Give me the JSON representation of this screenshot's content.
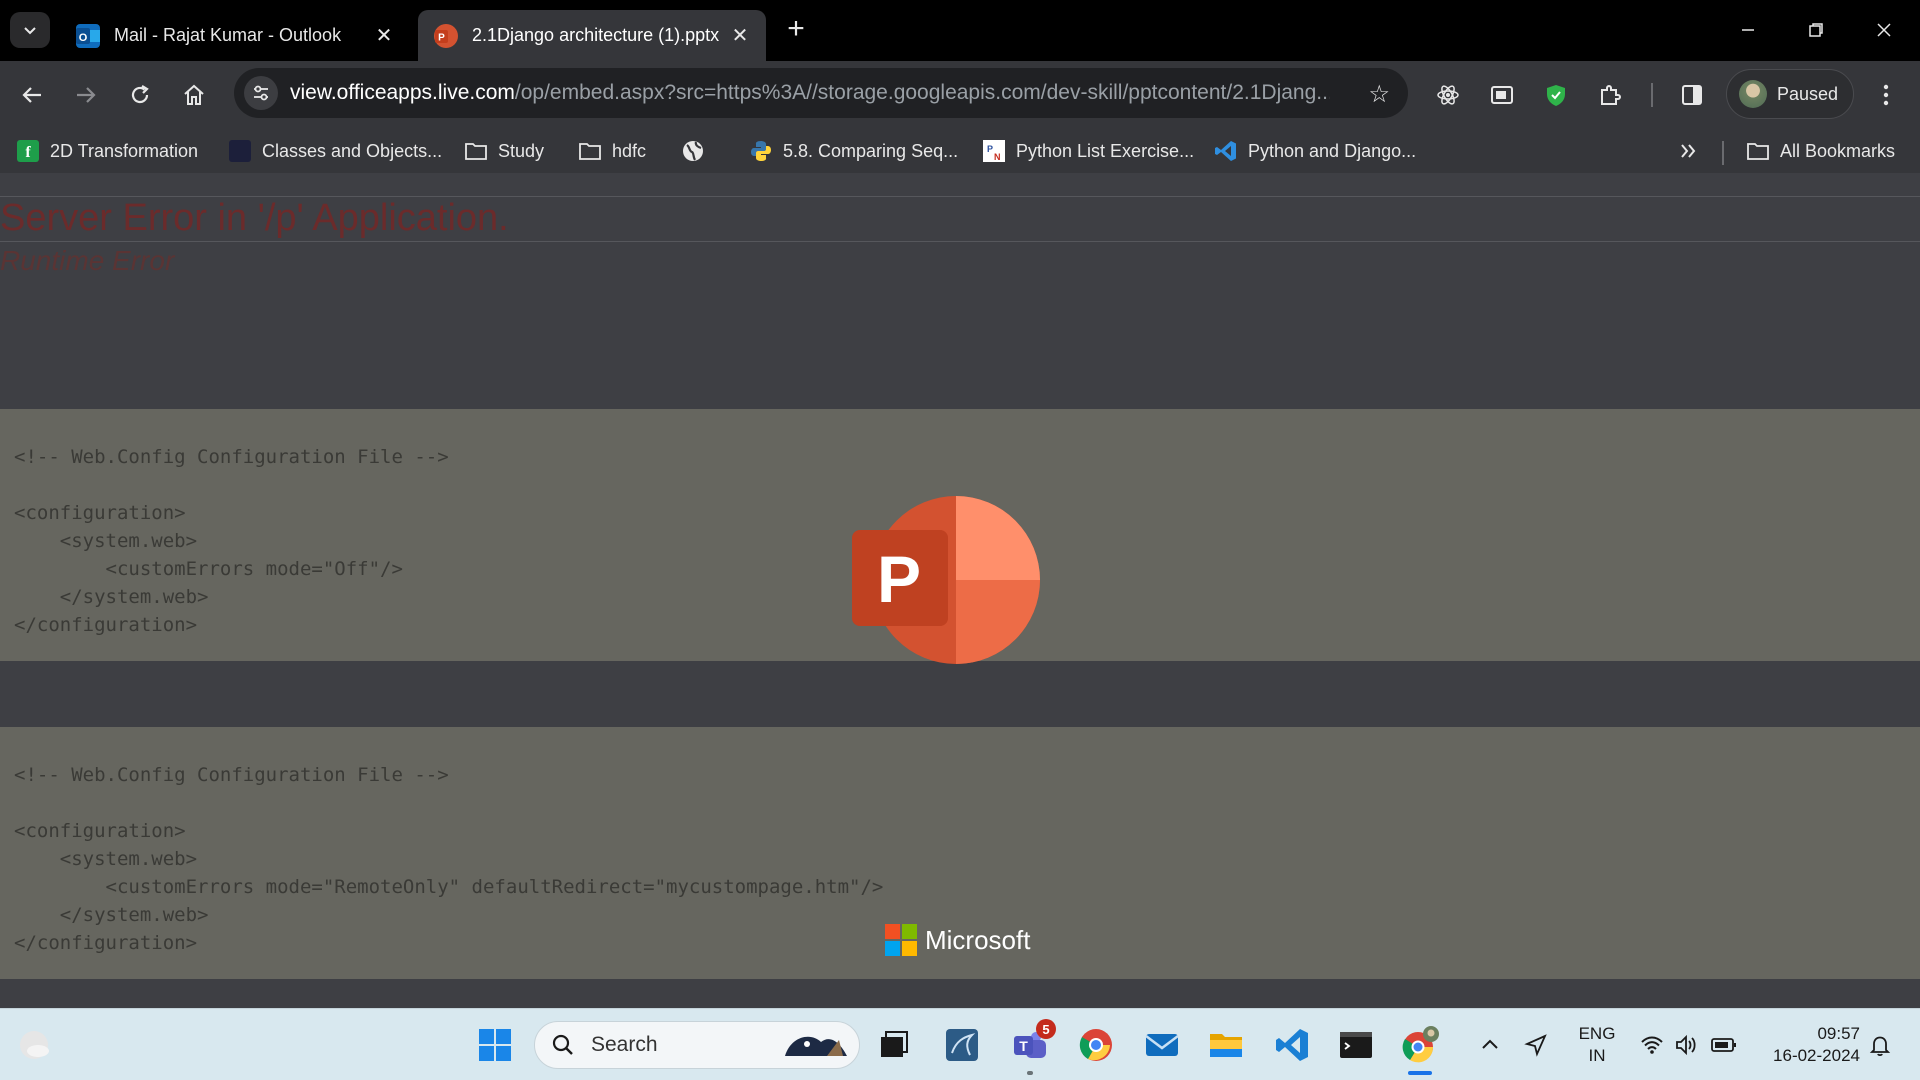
{
  "browser": {
    "tabs": [
      {
        "title": "Mail - Rajat Kumar - Outlook",
        "icon": "outlook-icon",
        "active": false
      },
      {
        "title": "2.1Django architecture (1).pptx",
        "icon": "powerpoint-icon",
        "active": true
      }
    ],
    "url_host": "view.officeapps.live.com",
    "url_path": "/op/embed.aspx?src=https%3A//storage.googleapis.com/dev-skill/pptcontent/2.1Djang...",
    "profile_status": "Paused"
  },
  "bookmarks": [
    {
      "label": "2D Transformation",
      "icon": "green-app-icon"
    },
    {
      "label": "Classes and Objects...",
      "icon": "dark-site-icon"
    },
    {
      "label": "Study",
      "icon": "folder-icon"
    },
    {
      "label": "hdfc",
      "icon": "folder-icon"
    },
    {
      "label": "",
      "icon": "globe-icon"
    },
    {
      "label": "5.8. Comparing Seq...",
      "icon": "python-icon"
    },
    {
      "label": "Python List Exercise...",
      "icon": "pynative-icon"
    },
    {
      "label": "Python and Django...",
      "icon": "vscode-icon"
    },
    {
      "label": "All Bookmarks",
      "icon": "folder-icon"
    }
  ],
  "page": {
    "error_title": "Server Error in '/p' Application.",
    "error_subtitle": "Runtime Error",
    "code_block_1": "<!-- Web.Config Configuration File -->\n\n<configuration>\n    <system.web>\n        <customErrors mode=\"Off\"/>\n    </system.web>\n</configuration>",
    "code_block_2": "<!-- Web.Config Configuration File -->\n\n<configuration>\n    <system.web>\n        <customErrors mode=\"RemoteOnly\" defaultRedirect=\"mycustompage.htm\"/>\n    </system.web>\n</configuration>",
    "ppt_letter": "P",
    "brand": "Microsoft"
  },
  "taskbar": {
    "search_placeholder": "Search",
    "teams_badge": "5",
    "language_line1": "ENG",
    "language_line2": "IN",
    "time": "09:57",
    "date": "16-02-2024"
  },
  "colors": {
    "error_red": "#6b2b2b",
    "code_bg": "#66665f",
    "page_bg": "#3e3f44",
    "ppt_orange": "#d35230",
    "ppt_light": "#ff8f6b",
    "ppt_dark": "#c43e1c"
  }
}
